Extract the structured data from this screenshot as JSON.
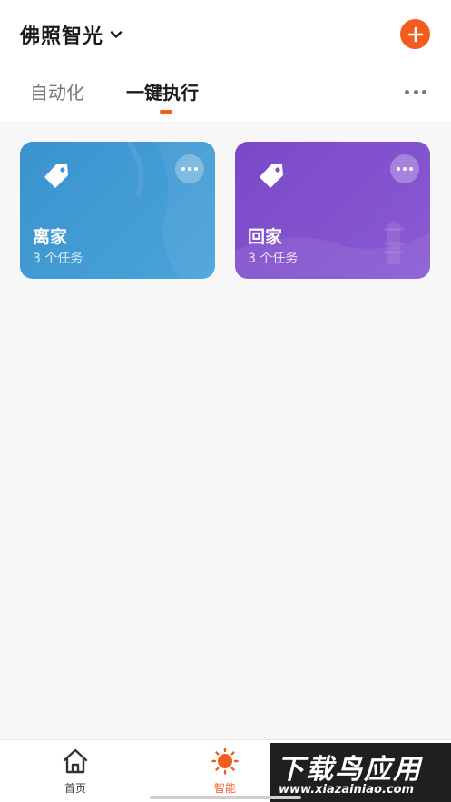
{
  "header": {
    "home_name": "佛照智光",
    "chevron_icon": "chevron-down-icon",
    "add_icon": "plus-icon",
    "accent": "#f25c1e"
  },
  "tabs": [
    {
      "label": "自动化",
      "active": false
    },
    {
      "label": "一键执行",
      "active": true
    }
  ],
  "scenes": [
    {
      "name": "离家",
      "tasks": "3 个任务",
      "color": "#3b93cf",
      "icon": "tag-icon"
    },
    {
      "name": "回家",
      "tasks": "3 个任务",
      "color": "#7a49c9",
      "icon": "tag-icon"
    }
  ],
  "bottom_nav": [
    {
      "label": "首页",
      "icon": "home-icon",
      "active": false
    },
    {
      "label": "智能",
      "icon": "sun-icon",
      "active": true
    }
  ],
  "watermark": {
    "title": "下载鸟应用",
    "url": "www.xiazainiao.com"
  }
}
